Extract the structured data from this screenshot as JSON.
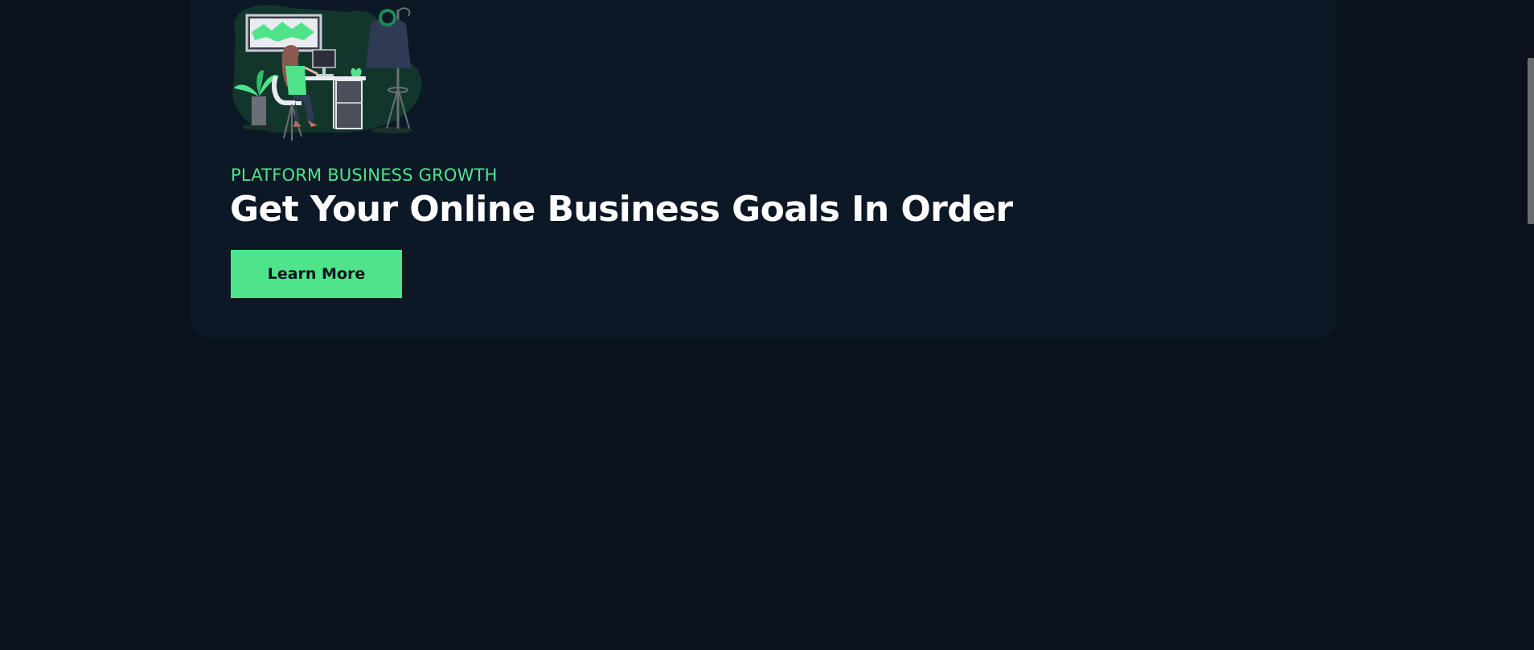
{
  "hero": {
    "eyebrow": "PLATFORM BUSINESS GROWTH",
    "headline": "Get Your Online Business Goals In Order",
    "cta_label": "Learn More",
    "illustration_icon": "woman-at-desk-illustration"
  },
  "colors": {
    "page_background": "#0a121d",
    "card_background": "#0c1826",
    "accent": "#4fe48b",
    "headline": "#ffffff"
  }
}
